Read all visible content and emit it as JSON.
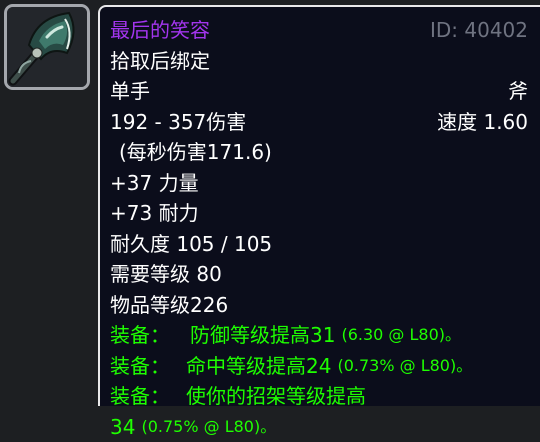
{
  "item": {
    "name": "最后的笑容",
    "id_label": "ID: 40402",
    "binding": "拾取后绑定",
    "slot": "单手",
    "type": "斧",
    "damage": "192 - 357伤害",
    "speed": "速度 1.60",
    "dps": "(每秒伤害171.6)",
    "stat_strength": "+37 力量",
    "stat_stamina": "+73 耐力",
    "durability": "耐久度 105 / 105",
    "required_level": "需要等级 80",
    "item_level": "物品等级226"
  },
  "effects": [
    {
      "label": "装备：",
      "text": "防御等级提高31",
      "detail": "(6.30 @ L80)。"
    },
    {
      "label": "装备：",
      "text": "命中等级提高24",
      "detail": "(0.73% @ L80)。"
    },
    {
      "label": "装备：",
      "text": "使你的招架等级提高",
      "cont_value": "34",
      "detail": "(0.75% @ L80)。"
    }
  ],
  "colors": {
    "epic_purple": "#a335ee",
    "equip_green": "#1eff00",
    "id_gray": "#6f7381",
    "tooltip_bg": "#0b0d1b"
  },
  "icon": "axe-icon"
}
